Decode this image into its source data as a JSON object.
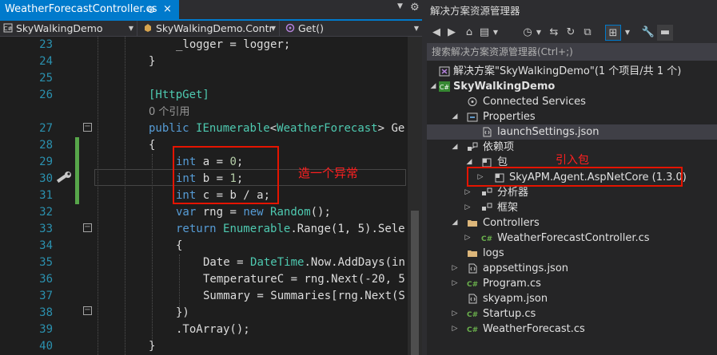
{
  "editor": {
    "tab_title": "WeatherForecastController.cs",
    "tab_pin": "⊕",
    "tab_close": "×",
    "nav_project": "SkyWalkingDemo",
    "nav_class": "SkyWalkingDemo.Contr",
    "nav_member": "Get()",
    "line_numbers": [
      "23",
      "24",
      "25",
      "26",
      "27",
      "28",
      "29",
      "30",
      "31",
      "32",
      "33",
      "34",
      "35",
      "36",
      "37",
      "38",
      "39",
      "40"
    ],
    "lines": {
      "l23": "_logger = logger;",
      "l24": "}",
      "l26": "[HttpGet]",
      "l26b": "0 个引用",
      "l27_pub": "public",
      "l27_ienum": "IEnumerable",
      "l27_lt": "<",
      "l27_wf": "WeatherForecast",
      "l27_rest": "> Ge",
      "l28": "{",
      "l29_kw": "int",
      "l29_rest": " a = ",
      "l29_num": "0",
      "l29_end": ";",
      "l30_kw": "int",
      "l30_rest": " b = ",
      "l30_num": "1",
      "l30_end": ";",
      "l31_kw": "int",
      "l31_rest": " c = b / a;",
      "l32_kw": "var",
      "l32_rest": " rng = ",
      "l32_new": "new",
      "l32_type": "Random",
      "l32_end": "();",
      "l33_ret": "return",
      "l33_type": "Enumerable",
      "l33_rest": ".Range(1, 5).Sele",
      "l34": "{",
      "l35_a": "Date = ",
      "l35_type": "DateTime",
      "l35_rest": ".Now.AddDays(in",
      "l36": "TemperatureC = rng.Next(-20, 5",
      "l37": "Summary = Summaries[rng.Next(S",
      "l38": "})",
      "l39": ".ToArray();",
      "l40": "}"
    },
    "annotation": "造一个异常"
  },
  "explorer": {
    "title": "解决方案资源管理器",
    "search_placeholder": "搜索解决方案资源管理器(Ctrl+;)",
    "annotation": "引入包",
    "tree": [
      {
        "label": "解决方案\"SkyWalkingDemo\"(1 个项目/共 1 个)",
        "icon": "solution-icon"
      },
      {
        "label": "SkyWalkingDemo",
        "icon": "csharp-project-icon"
      },
      {
        "label": "Connected Services",
        "icon": "connected-services-icon"
      },
      {
        "label": "Properties",
        "icon": "properties-icon"
      },
      {
        "label": "launchSettings.json",
        "icon": "json-file-icon"
      },
      {
        "label": "依赖项",
        "icon": "dependencies-icon"
      },
      {
        "label": "包",
        "icon": "package-icon"
      },
      {
        "label": "SkyAPM.Agent.AspNetCore (1.3.0)",
        "icon": "nuget-package-icon"
      },
      {
        "label": "分析器",
        "icon": "analyzer-icon"
      },
      {
        "label": "框架",
        "icon": "framework-icon"
      },
      {
        "label": "Controllers",
        "icon": "folder-icon"
      },
      {
        "label": "WeatherForecastController.cs",
        "icon": "csharp-file-icon"
      },
      {
        "label": "logs",
        "icon": "folder-icon"
      },
      {
        "label": "appsettings.json",
        "icon": "json-file-icon"
      },
      {
        "label": "Program.cs",
        "icon": "csharp-file-icon"
      },
      {
        "label": "skyapm.json",
        "icon": "json-file-icon"
      },
      {
        "label": "Startup.cs",
        "icon": "csharp-file-icon"
      },
      {
        "label": "WeatherForecast.cs",
        "icon": "csharp-file-icon"
      }
    ]
  },
  "colors": {
    "accent": "#007acc",
    "highlight_red": "#e51400",
    "keyword_blue": "#569cd6",
    "type_teal": "#4ec9b0",
    "line_number": "#2b91af"
  }
}
